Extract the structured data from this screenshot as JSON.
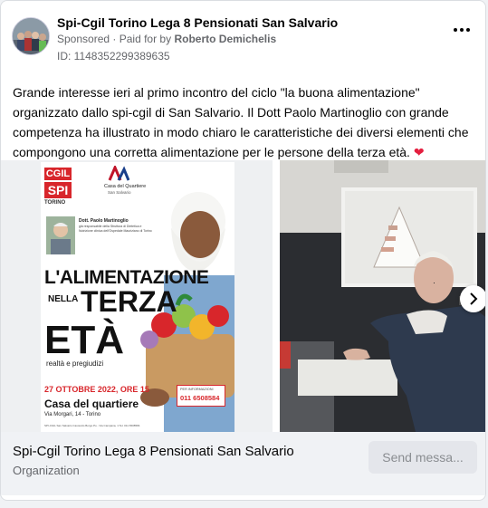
{
  "post": {
    "page_name": "Spi-Cgil Torino Lega 8 Pensionati San Salvario",
    "sponsored": "Sponsored",
    "paid_prefix": "Paid for by",
    "paid_by": "Roberto Demichelis",
    "ad_id": "ID: 1148352299389635",
    "body": "Grande interesse ieri al primo incontro del ciclo \"la buona alimentazione\" organizzato dallo spi-cgil di San Salvario. Il Dott Paolo Martinoglio con grande competenza ha illustrato in modo chiaro le caratteristiche dei diversi elementi che compongono una corretta alimentazione per le persone della terza età.",
    "more_icon": "more-horizontal-icon"
  },
  "poster": {
    "cgil": "CGIL",
    "spi": "SPI",
    "torino": "TORINO",
    "casa": "Casa del Quartiere",
    "casa_sub": "San Salvario",
    "speaker_name": "Dott. Paolo Martinoglio",
    "speaker_desc1": "già responsabile della Struttura di Dietetica e",
    "speaker_desc2": "Nutrizione clinica dell'Ospedale Mauriziano di Torino",
    "title1": "L'ALIMENTAZIONE",
    "title_nella": "NELLA",
    "title2": "TERZA",
    "title3": "ETÀ",
    "subtitle": "realtà e pregiudizi",
    "date": "27 OTTOBRE 2022, ORE 15",
    "place": "Casa del quartiere",
    "address1": "Via Morgari, 14 - Torino",
    "info_label": "PER INFORMAZIONI",
    "info_phone": "011 6508584",
    "footer_small": "SPI-CGIL San Salvario Cavoretto Borgo Po - Via Campana, 1 Tel. 011 6508584"
  },
  "footer": {
    "title": "Spi-Cgil Torino Lega 8 Pensionati San Salvario",
    "subtitle": "Organization",
    "send_label": "Send messa..."
  }
}
